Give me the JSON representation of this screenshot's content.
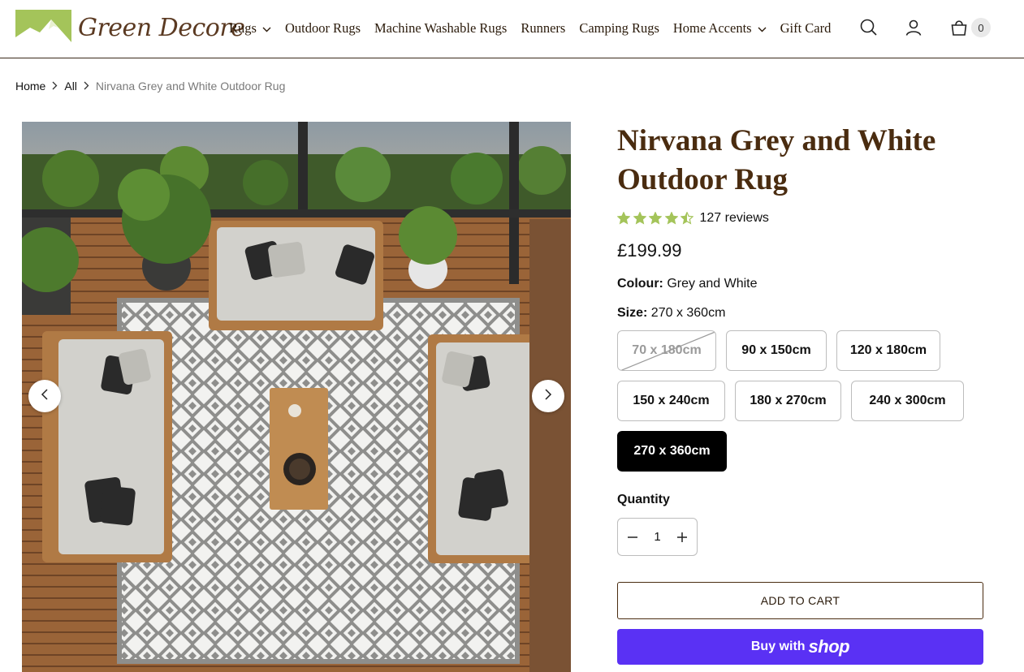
{
  "brand": {
    "name": "Green Decore"
  },
  "nav": {
    "items": [
      {
        "label": "Rugs",
        "dropdown": true
      },
      {
        "label": "Outdoor Rugs",
        "dropdown": false
      },
      {
        "label": "Machine Washable Rugs",
        "dropdown": false
      },
      {
        "label": "Runners",
        "dropdown": false
      },
      {
        "label": "Camping Rugs",
        "dropdown": false
      },
      {
        "label": "Home Accents",
        "dropdown": true
      },
      {
        "label": "Gift Card",
        "dropdown": false
      }
    ],
    "cart_count": "0"
  },
  "breadcrumb": {
    "home": "Home",
    "all": "All",
    "current": "Nirvana Grey and White Outdoor Rug"
  },
  "product": {
    "title": "Nirvana Grey and White Outdoor Rug",
    "rating_value": 4.5,
    "reviews": "127 reviews",
    "price": "£199.99",
    "colour_label": "Colour:",
    "colour_value": "Grey and White",
    "size_label": "Size:",
    "size_value": "270 x 360cm",
    "sizes": [
      {
        "label": "70 x 180cm",
        "state": "unavailable"
      },
      {
        "label": "90 x 150cm",
        "state": "available"
      },
      {
        "label": "120 x 180cm",
        "state": "available"
      },
      {
        "label": "150 x 240cm",
        "state": "available"
      },
      {
        "label": "180 x 270cm",
        "state": "available"
      },
      {
        "label": "240 x 300cm",
        "state": "available"
      },
      {
        "label": "270 x 360cm",
        "state": "selected"
      }
    ],
    "quantity_label": "Quantity",
    "quantity_value": "1",
    "add_to_cart": "ADD TO CART",
    "buy_with": "Buy with",
    "buy_brand": "shop"
  },
  "colors": {
    "accent_brown": "#4a2c10",
    "star_green": "#a4c45a",
    "shop_purple": "#5a31f4",
    "logo_green": "#a4c45a"
  },
  "icons": {
    "search": "search-icon",
    "account": "user-icon",
    "cart": "cart-icon",
    "prev": "chevron-left-icon",
    "next": "chevron-right-icon",
    "minus": "minus-icon",
    "plus": "plus-icon"
  }
}
